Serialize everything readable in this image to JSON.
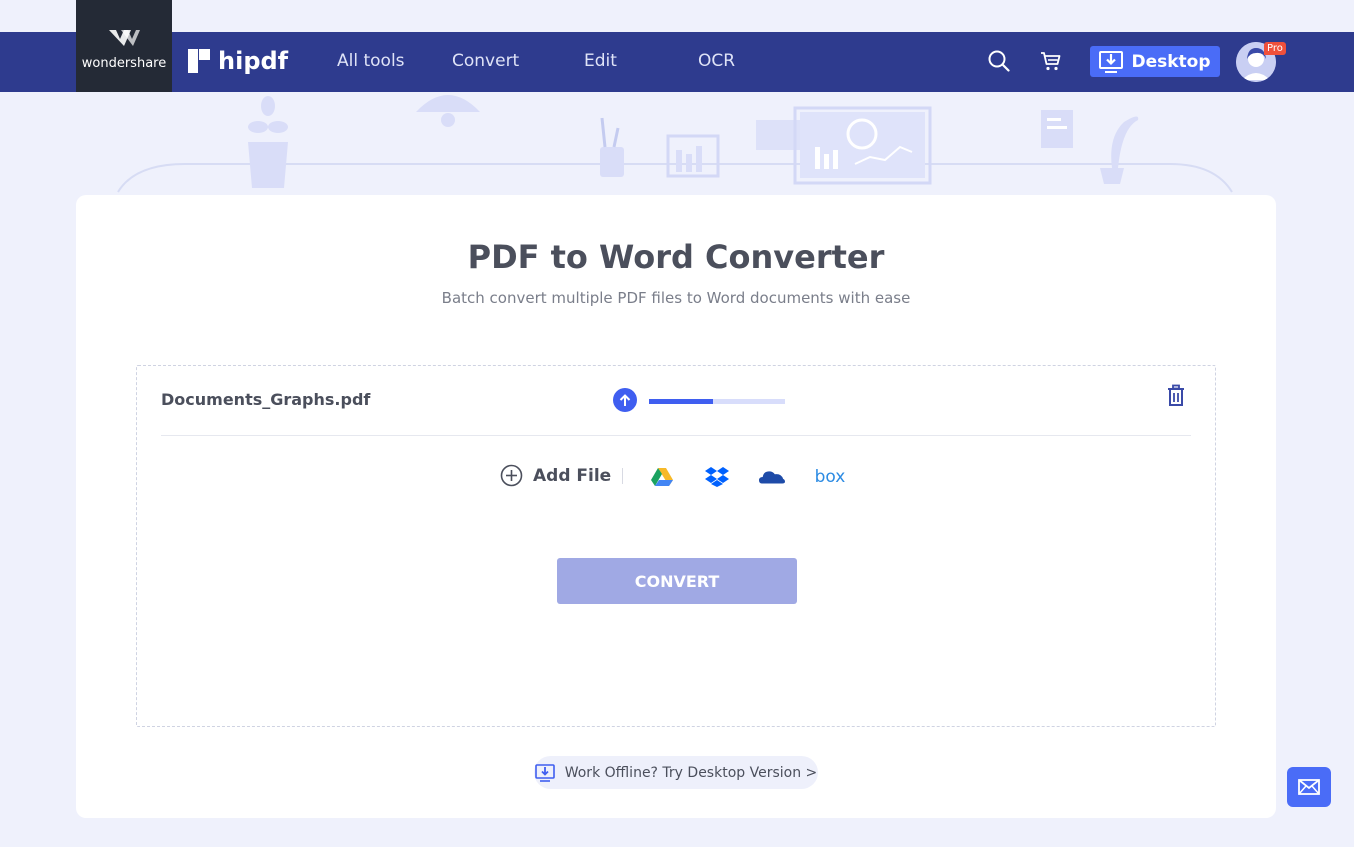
{
  "header": {
    "brand": "wondershare",
    "product": "hipdf",
    "nav": [
      {
        "label": "All tools"
      },
      {
        "label": "Convert"
      },
      {
        "label": "Edit"
      },
      {
        "label": "OCR"
      }
    ],
    "desktop_label": "Desktop",
    "pro_badge": "Pro",
    "icons": [
      "search-icon",
      "cart-icon",
      "download-desktop-icon",
      "avatar"
    ]
  },
  "main": {
    "title": "PDF to Word Converter",
    "subtitle": "Batch convert multiple PDF files to Word documents with ease",
    "file": {
      "name": "Documents_Graphs.pdf",
      "upload_progress": 0.47
    },
    "add_file_label": "Add File",
    "cloud_sources": [
      "google-drive-icon",
      "dropbox-icon",
      "onedrive-icon",
      "box-icon"
    ],
    "box_label": "box",
    "convert_label": "CONVERT",
    "offline_label": "Work Offline? Try Desktop Version >"
  },
  "colors": {
    "nav_bg": "#2e3b8e",
    "accent": "#4a6cf7",
    "convert_disabled": "#a0a9e4",
    "page_bg": "#eff1fc",
    "pro_badge": "#f0503b"
  }
}
